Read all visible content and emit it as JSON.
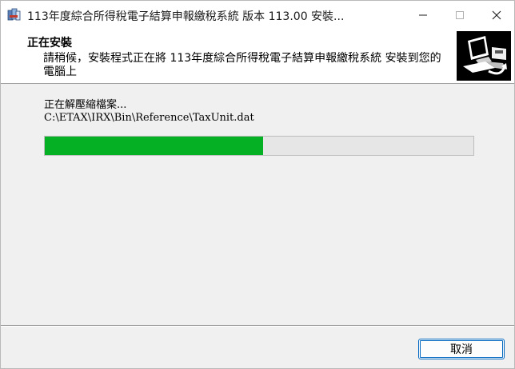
{
  "window": {
    "title": "113年度綜合所得稅電子結算申報繳稅系統 版本 113.00 安裝...",
    "minimize_icon": "minimize-icon",
    "maximize_icon": "maximize-icon",
    "close_icon": "close-icon"
  },
  "header": {
    "title": "正在安裝",
    "subtitle": "請稍候，安裝程式正在將 113年度綜合所得稅電子結算申報繳稅系統 安裝到您的電腦上",
    "logo_icon": "installer-computer-icon"
  },
  "main": {
    "status_label": "正在解壓縮檔案...",
    "current_file": "C:\\ETAX\\IRX\\Bin\\Reference\\TaxUnit.dat",
    "progress": {
      "percent": 51,
      "fill_color": "#06b025"
    }
  },
  "footer": {
    "cancel_label": "取消"
  }
}
